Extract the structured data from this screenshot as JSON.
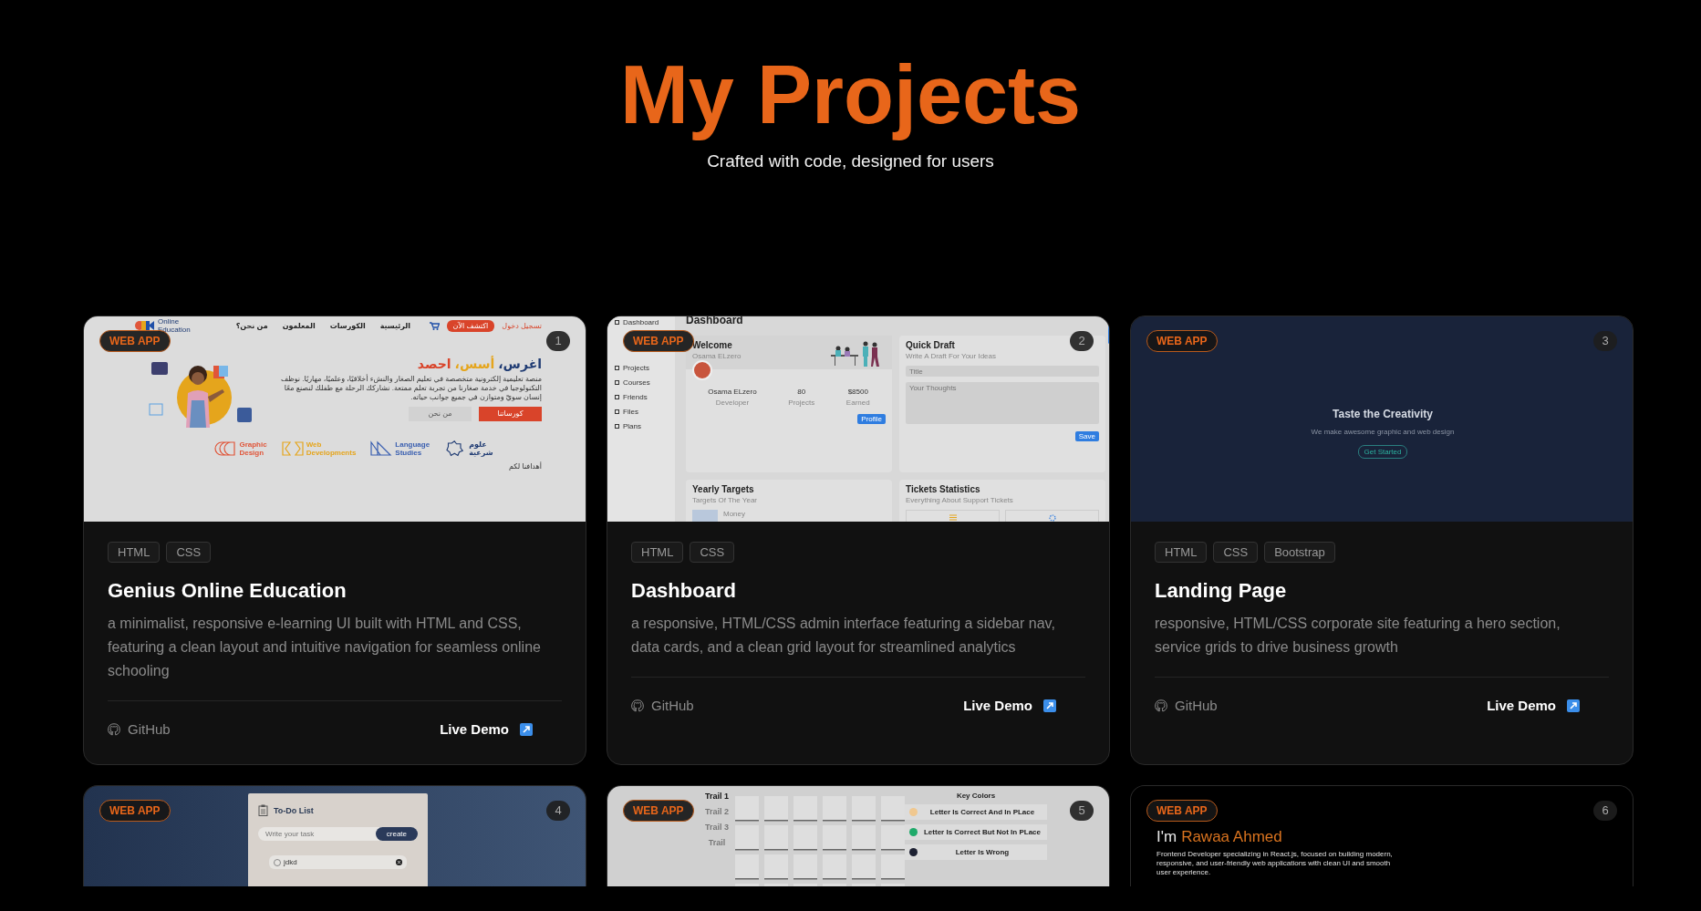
{
  "header": {
    "title": "My Projects",
    "subtitle": "Crafted with code, designed for users"
  },
  "projects": [
    {
      "badge": "WEB APP",
      "number": "1",
      "tags": [
        "HTML",
        "CSS"
      ],
      "title": "Genius Online Education",
      "description": "a minimalist, responsive e-learning UI built with HTML and CSS, featuring a clean layout and intuitive navigation for seamless online schooling",
      "links": [
        {
          "label": "GitHub",
          "kind": "github"
        },
        {
          "label": "Live Demo",
          "kind": "demo"
        }
      ],
      "preview": {
        "kind": "education",
        "logo": "Online Education",
        "nav": [
          "الرئيسية",
          "الكورسات",
          "المعلمون",
          "من نحن؟"
        ],
        "login": "تسجيل دخول",
        "cta": "اكتشف الآن",
        "headline": [
          {
            "text": "اغرس،",
            "color": "#1f3b73"
          },
          {
            "text": "أسس،",
            "color": "#e5a51c"
          },
          {
            "text": "احصد",
            "color": "#d9442a"
          }
        ],
        "text": "منصة تعليمية إلكترونية متخصصة في تعليم الصغار والنشء أخلاقيًا، وعلميًا، مهاريًا. نوظف التكنولوجيا في خدمة صغارنا من تجربة تعلم ممتعة. نشاركك الرحلة مع طفلك لنصنع معًا إنسان سويّ ومتوازن في جميع جوانب حياته.",
        "buttons": [
          {
            "label": "كورساتنا",
            "kind": "primary"
          },
          {
            "label": "من نحن",
            "kind": "secondary"
          }
        ],
        "categories": [
          {
            "label": "Graphic Design",
            "color": "#e0563a",
            "kind": "arcs"
          },
          {
            "label": "Web Developments",
            "color": "#e5a51c",
            "kind": "brackets"
          },
          {
            "label": "Language Studies",
            "color": "#3a5fb0",
            "kind": "triangles"
          },
          {
            "label": "علوم شرعية",
            "color": "#1f3b73",
            "kind": "star"
          }
        ],
        "footer": "أهدافنا لكم"
      }
    },
    {
      "badge": "WEB APP",
      "number": "2",
      "tags": [
        "HTML",
        "CSS"
      ],
      "title": "Dashboard",
      "description": "a responsive, HTML/CSS admin interface featuring a sidebar nav, data cards, and a clean grid layout for streamlined analytics",
      "links": [
        {
          "label": "GitHub",
          "kind": "github"
        },
        {
          "label": "Live Demo",
          "kind": "demo"
        }
      ],
      "preview": {
        "kind": "dashboard",
        "sidebar": [
          "Dashboard",
          "Projects",
          "Courses",
          "Friends",
          "Files",
          "Plans"
        ],
        "heading": "Dashboard",
        "welcome": {
          "title": "Welcome",
          "name": "Osama ELzero",
          "stats": [
            {
              "value": "Osama ELzero",
              "label": "Developer"
            },
            {
              "value": "80",
              "label": "Projects"
            },
            {
              "value": "$8500",
              "label": "Earned"
            }
          ],
          "button": "Profile"
        },
        "draft": {
          "title": "Quick Draft",
          "subtitle": "Write A Draft For Your Ideas",
          "fields": [
            {
              "kind": "input",
              "placeholder": "Title"
            },
            {
              "kind": "textarea",
              "placeholder": "Your Thoughts"
            }
          ],
          "button": "Save"
        },
        "targets": {
          "title": "Yearly Targets",
          "subtitle": "Targets Of The Year",
          "label": "Money"
        },
        "tickets": {
          "title": "Tickets Statistics",
          "subtitle": "Everything About Support Tickets"
        }
      }
    },
    {
      "badge": "WEB APP",
      "number": "3",
      "tags": [
        "HTML",
        "CSS",
        "Bootstrap"
      ],
      "title": "Landing Page",
      "description": "responsive, HTML/CSS corporate site featuring a hero section, service grids to drive business growth",
      "links": [
        {
          "label": "GitHub",
          "kind": "github"
        },
        {
          "label": "Live Demo",
          "kind": "demo"
        }
      ],
      "preview": {
        "kind": "landing",
        "title": "Taste the Creativity",
        "text": "We make awesome graphic and web design",
        "button": "Get Started"
      }
    },
    {
      "badge": "WEB APP",
      "number": "4",
      "preview": {
        "kind": "todo",
        "title": "To-Do List",
        "placeholder": "Write your task",
        "button": "create",
        "items": [
          {
            "text": "jdkd",
            "checked": false
          }
        ]
      }
    },
    {
      "badge": "WEB APP",
      "number": "5",
      "preview": {
        "kind": "wordle",
        "trails": [
          {
            "label": "Trail 1",
            "selected": true
          },
          {
            "label": "Trail 2",
            "selected": false
          },
          {
            "label": "Trail 3",
            "selected": false
          },
          {
            "label": "Trail",
            "selected": false
          }
        ],
        "key_title": "Key Colors",
        "keys": [
          {
            "text": "Letter Is Correct And In PLace",
            "color": "#f0c890"
          },
          {
            "text": "Letter Is Correct But Not In PLace",
            "color": "#1faa6a"
          },
          {
            "text": "Letter Is Wrong",
            "color": "#1e2233"
          }
        ]
      }
    },
    {
      "badge": "WEB APP",
      "number": "6",
      "preview": {
        "kind": "portfolio",
        "greeting": "I'm",
        "name": "Rawaa Ahmed",
        "text": "Frontend Developer specializing in React.js, focused on building modern, responsive, and user-friendly web applications with clean UI and smooth user experience."
      }
    }
  ]
}
